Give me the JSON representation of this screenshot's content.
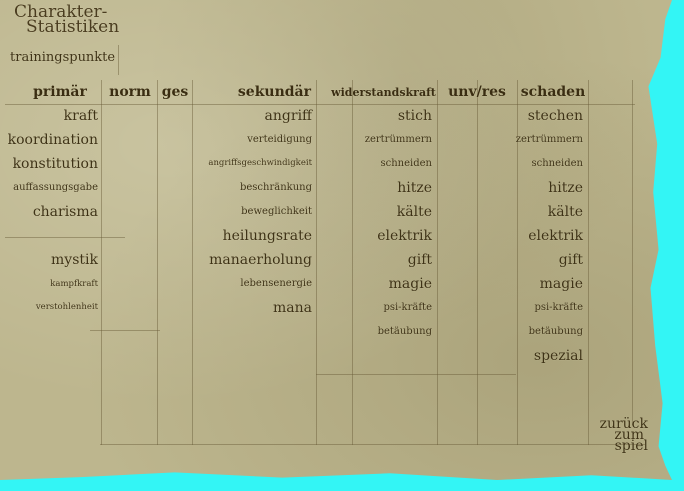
{
  "title": {
    "line1": "Charakter-",
    "line2": "Statistiken"
  },
  "training_points_label": "trainingspunkte",
  "headers": {
    "primary": "primär",
    "norm": "norm",
    "ges": "ges",
    "secondary": "sekundär",
    "resistance": "widerstandskraft",
    "unv_res": "unv/res",
    "damage": "schaden"
  },
  "primary": [
    "kraft",
    "koordination",
    "konstitution",
    "auffassungsgabe",
    "charisma"
  ],
  "primary2": [
    "mystik",
    "kampfkraft",
    "verstohlenheit"
  ],
  "secondary": [
    "angriff",
    "verteidigung",
    "angriffsgeschwindigkeit",
    "beschränkung",
    "beweglichkeit",
    "heilungsrate",
    "manaerholung",
    "lebensenergie",
    "mana"
  ],
  "resistance": [
    "stich",
    "zertrümmern",
    "schneiden",
    "hitze",
    "kälte",
    "elektrik",
    "gift",
    "magie",
    "psi-kräfte",
    "betäubung"
  ],
  "damage": [
    "stechen",
    "zertrümmern",
    "schneiden",
    "hitze",
    "kälte",
    "elektrik",
    "gift",
    "magie",
    "psi-kräfte",
    "betäubung",
    "spezial"
  ],
  "back_button": {
    "line1": "zurück",
    "line2": "zum",
    "line3": "spiel"
  },
  "colors": {
    "parchment": "#bdb68e",
    "ink": "#3e3216",
    "border": "#33f5f5"
  }
}
